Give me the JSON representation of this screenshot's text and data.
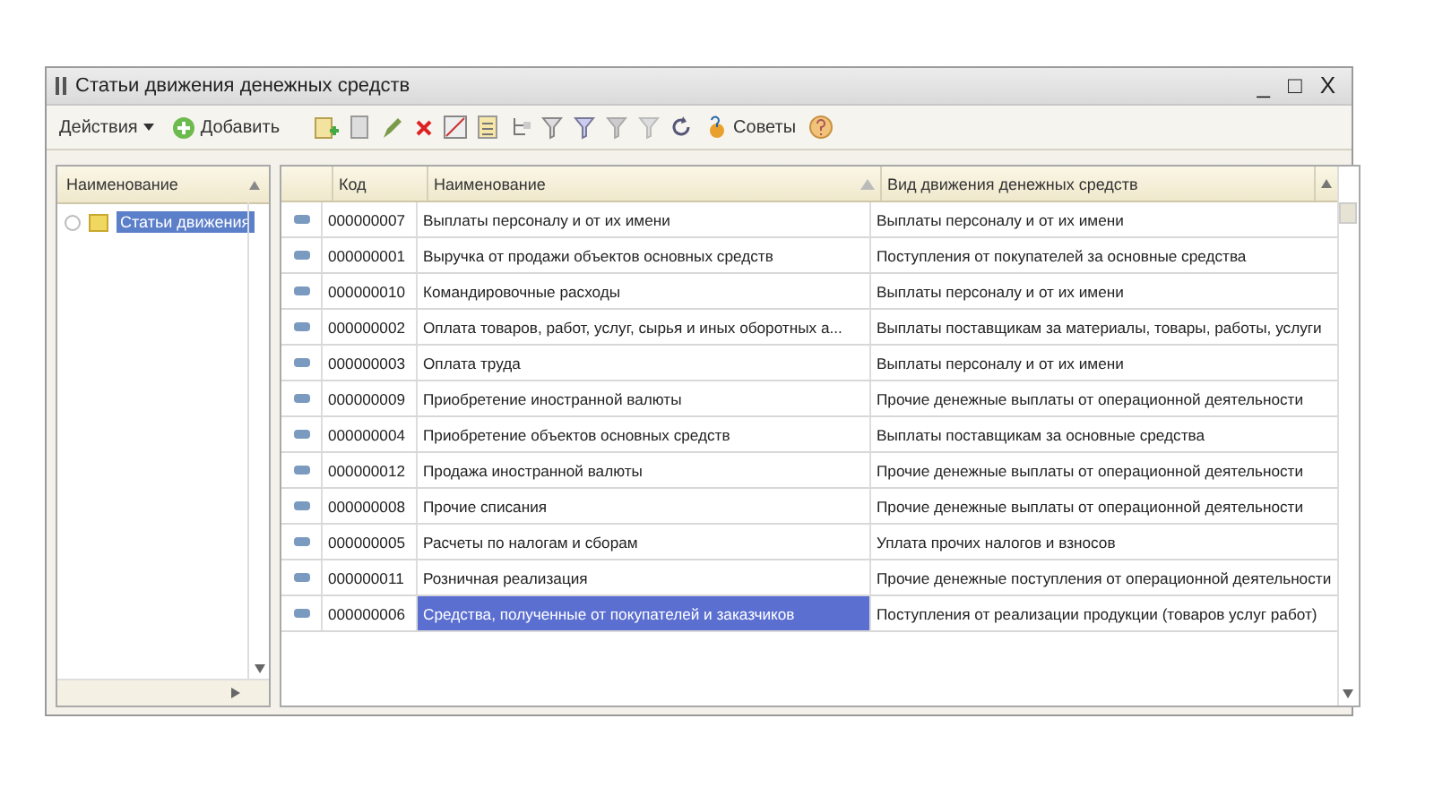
{
  "window": {
    "title": "Статьи движения денежных средств",
    "controls": [
      "_",
      "□",
      "X"
    ]
  },
  "toolbar": {
    "actions_menu": "Действия",
    "add_button": "Добавить",
    "tips_button": "Советы"
  },
  "tree": {
    "header": "Наименование",
    "items": [
      {
        "label": "Статьи движения",
        "selected": true
      }
    ]
  },
  "table": {
    "columns": [
      {
        "label": "Код",
        "sorted": false
      },
      {
        "label": "Наименование",
        "sorted": true
      },
      {
        "label": "Вид движения денежных средств",
        "sorted": false
      }
    ],
    "rows": [
      {
        "code": "000000007",
        "name": "Выплаты персоналу и от их имени",
        "kind": "Выплаты персоналу и от их имени",
        "selected": false
      },
      {
        "code": "000000001",
        "name": "Выручка от продажи объектов основных средств",
        "kind": "Поступления от покупателей за основные средства",
        "selected": false
      },
      {
        "code": "000000010",
        "name": "Командировочные расходы",
        "kind": "Выплаты персоналу и от их имени",
        "selected": false
      },
      {
        "code": "000000002",
        "name": "Оплата товаров, работ, услуг, сырья и иных оборотных а...",
        "kind": "Выплаты поставщикам за материалы, товары, работы, услуги",
        "selected": false
      },
      {
        "code": "000000003",
        "name": "Оплата труда",
        "kind": "Выплаты персоналу и от их имени",
        "selected": false
      },
      {
        "code": "000000009",
        "name": "Приобретение иностранной валюты",
        "kind": "Прочие денежные выплаты от операционной деятельности",
        "selected": false
      },
      {
        "code": "000000004",
        "name": "Приобретение объектов основных средств",
        "kind": "Выплаты поставщикам за основные средства",
        "selected": false
      },
      {
        "code": "000000012",
        "name": "Продажа иностранной валюты",
        "kind": "Прочие денежные выплаты от операционной деятельности",
        "selected": false
      },
      {
        "code": "000000008",
        "name": "Прочие списания",
        "kind": "Прочие денежные выплаты от операционной деятельности",
        "selected": false
      },
      {
        "code": "000000005",
        "name": "Расчеты по налогам и сборам",
        "kind": "Уплата прочих налогов и взносов",
        "selected": false
      },
      {
        "code": "000000011",
        "name": "Розничная реализация",
        "kind": "Прочие денежные поступления от операционной деятельности",
        "selected": false
      },
      {
        "code": "000000006",
        "name": "Средства, полученные от покупателей и заказчиков",
        "kind": "Поступления от реализации продукции (товаров услуг работ)",
        "selected": true
      }
    ]
  }
}
